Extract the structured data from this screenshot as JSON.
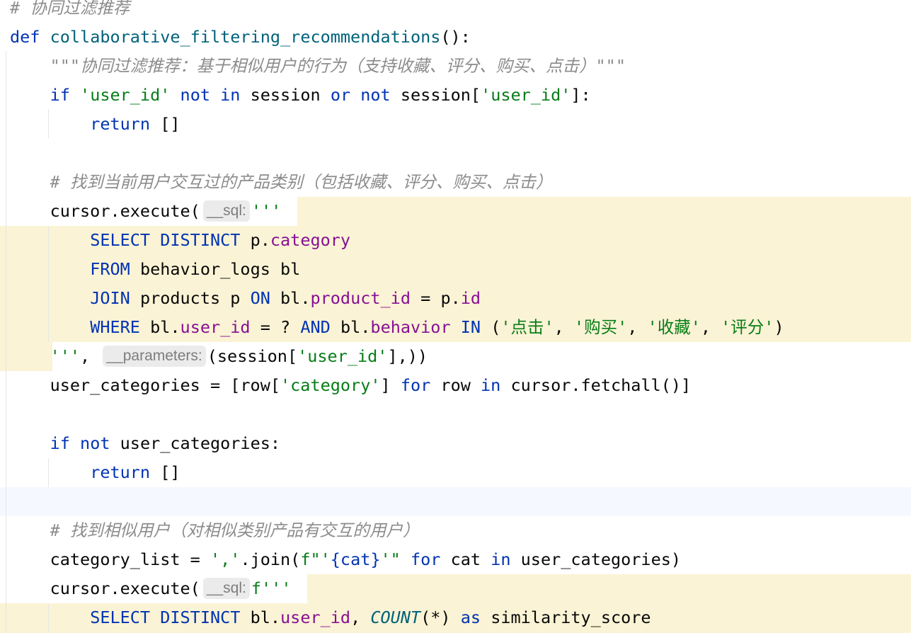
{
  "editor": {
    "language": "python",
    "colors": {
      "keyword": "#0033b3",
      "function": "#00627a",
      "string": "#067d17",
      "comment": "#8c8c8c",
      "field": "#871094",
      "sql_highlight_bg": "#fbf3d5",
      "caret_line_bg": "#f5f8fe",
      "hint_bg": "#ebebeb"
    },
    "code": {
      "l1": {
        "comment": "# 协同过滤推荐"
      },
      "l2": {
        "def": "def",
        "name": "collaborative_filtering_recommendations",
        "rest": "():"
      },
      "l3": {
        "docstring": "\"\"\"协同过滤推荐：基于相似用户的行为（支持收藏、评分、购买、点击）\"\"\""
      },
      "l4": {
        "if": "if",
        "s_user_id": "'user_id'",
        "not1": "not",
        "in1": "in",
        "session1": "session",
        "or": "or",
        "not2": "not",
        "session2": "session[",
        "s_user_id2": "'user_id'",
        "end": "]:"
      },
      "l5": {
        "return": "return",
        "rest": "[]"
      },
      "l7": {
        "comment": "# 找到当前用户交互过的产品类别（包括收藏、评分、购买、点击）"
      },
      "l8": {
        "call": "cursor.execute(",
        "hint": "__sql:",
        "str": "'''"
      },
      "l9": {
        "select": "SELECT",
        "distinct": "DISTINCT",
        "p": "p.",
        "field": "category"
      },
      "l10": {
        "from": "FROM",
        "rest": "behavior_logs bl"
      },
      "l11": {
        "join": "JOIN",
        "t": "products p",
        "on": "ON",
        "bl": "bl.",
        "f1": "product_id",
        "eq": "=",
        "p": "p.",
        "f2": "id"
      },
      "l12": {
        "where": "WHERE",
        "bl": "bl.",
        "f1": "user_id",
        "mid": "= ?",
        "and": "AND",
        "bl2": "bl.",
        "f2": "behavior",
        "in": "IN",
        "open": "(",
        "v1": "'点击'",
        "v2": "'购买'",
        "v3": "'收藏'",
        "v4": "'评分'",
        "close": ")",
        "comma": ", "
      },
      "l13": {
        "str": "'''",
        "comma": ",",
        "hint": "__parameters:",
        "rest1": "(session[",
        "s": "'user_id'",
        "rest2": "],))"
      },
      "l14": {
        "a": "user_categories = [row[",
        "s": "'category'",
        "b": "]",
        "for": "for",
        "c": "row",
        "in": "in",
        "d": "cursor.fetchall()]"
      },
      "l16": {
        "if": "if",
        "not": "not",
        "rest": "user_categories:"
      },
      "l17": {
        "return": "return",
        "rest": "[]"
      },
      "l19": {
        "comment": "# 找到相似用户（对相似类别产品有交互的用户）"
      },
      "l20": {
        "a": "category_list =",
        "s1": "','",
        "b": ".join(",
        "s2": "f\"'",
        "c": "{cat}",
        "s3": "'\"",
        "for": "for",
        "d": "cat",
        "in": "in",
        "e": "user_categories)"
      },
      "l21": {
        "call": "cursor.execute(",
        "hint": "__sql:",
        "str": "f'''"
      },
      "l22": {
        "select": "SELECT",
        "distinct": "DISTINCT",
        "bl": "bl.",
        "f": "user_id",
        "comma": ",",
        "count": "COUNT",
        "paren": "(*)",
        "as": "as",
        "alias": "similarity_score"
      }
    }
  }
}
